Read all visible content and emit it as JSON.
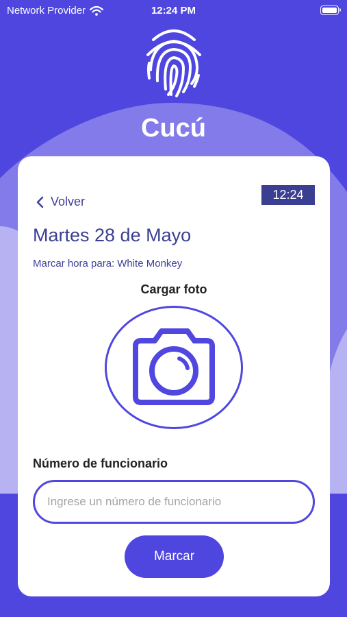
{
  "status_bar": {
    "carrier": "Network Provider",
    "time": "12:24 PM"
  },
  "header": {
    "app_title": "Cucú",
    "logo_icon": "fingerprint-icon"
  },
  "card": {
    "back_label": "Volver",
    "clock": "12:24",
    "date_title": "Martes 28 de Mayo",
    "mark_prefix": "Marcar hora para:",
    "mark_name": "White Monkey",
    "upload_title": "Cargar foto",
    "camera_icon": "camera-icon",
    "employee_label": "Número de funcionario",
    "employee_value": "",
    "employee_placeholder": "Ingrese un número de funcionario",
    "submit_label": "Marcar"
  },
  "colors": {
    "accent": "#4f46e0",
    "dark_badge": "#3b3f91",
    "card_background": "#ffffff"
  }
}
